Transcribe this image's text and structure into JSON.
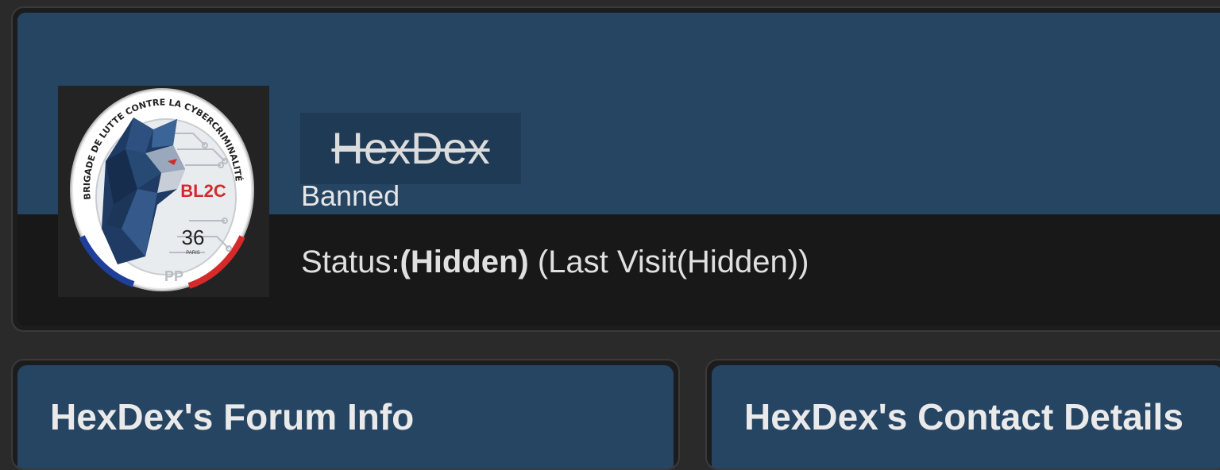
{
  "profile": {
    "avatar_icon": "bl2c-badge-avatar",
    "avatar_text": {
      "ring_text": "BRIGADE DE LUTTE CONTRE LA CYBERCRIMINALITÉ",
      "unit": "BL2C",
      "number": "36",
      "city": "PARIS"
    },
    "username": "HexDex",
    "group": "Banned",
    "status_label": "Status:",
    "status_value": "(Hidden)",
    "last_visit": " (Last Visit(Hidden))"
  },
  "panels": {
    "forum_info_title": "HexDex's Forum Info",
    "contact_details_title": "HexDex's Contact Details"
  },
  "colors": {
    "banner": "#264563",
    "page_bg": "#2a2a2a",
    "card_dark": "#181818",
    "text": "#e0e0e0"
  }
}
